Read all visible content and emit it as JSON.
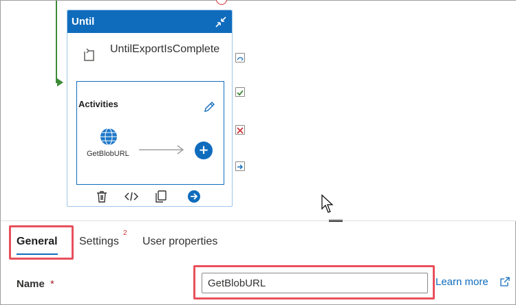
{
  "canvas": {
    "until_activity": {
      "header_title": "Until",
      "activity_name": "UntilExportIsComplete",
      "activities_label": "Activities",
      "inner_activity": {
        "name": "GetBlobURL"
      },
      "toolbar_icons": [
        "delete-icon",
        "code-icon",
        "copy-icon",
        "go-icon"
      ]
    },
    "side_status_icons": [
      "skip-icon",
      "success-icon",
      "failure-icon",
      "completion-icon"
    ]
  },
  "panel": {
    "tabs": {
      "general": "General",
      "settings": "Settings",
      "settings_badge": "2",
      "user_properties": "User properties"
    },
    "name_field": {
      "label": "Name",
      "required_marker": "*",
      "value": "GetBlobURL"
    },
    "learn_more": "Learn more"
  },
  "colors": {
    "accent": "#0f6cbd",
    "highlight": "#e8505b",
    "success": "#3d8b37",
    "failure": "#d13438"
  }
}
